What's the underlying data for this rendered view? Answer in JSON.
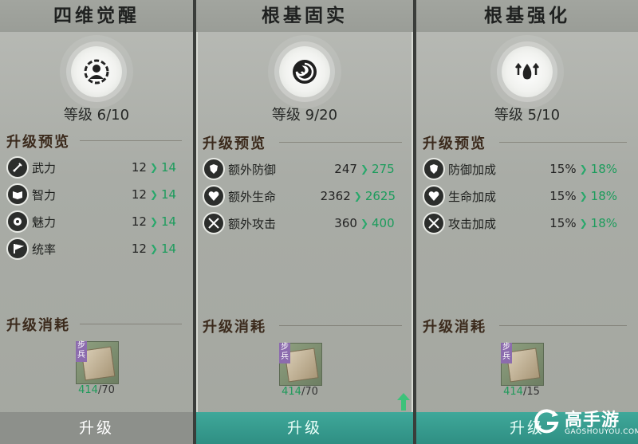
{
  "panels": [
    {
      "title": "四维觉醒",
      "emblem_icon": "person-badge-icon",
      "level": "等级 6/10",
      "preview_title": "升级预览",
      "stats": [
        {
          "icon": "sword-icon",
          "name": "武力",
          "old": "12",
          "new": "14"
        },
        {
          "icon": "book-icon",
          "name": "智力",
          "old": "12",
          "new": "14"
        },
        {
          "icon": "charm-icon",
          "name": "魅力",
          "old": "12",
          "new": "14"
        },
        {
          "icon": "banner-icon",
          "name": "统率",
          "old": "12",
          "new": "14"
        }
      ],
      "cost_title": "升级消耗",
      "cost_tag": "步兵",
      "cost_have": "414",
      "cost_need": "/70",
      "button": "升级"
    },
    {
      "title": "根基固实",
      "emblem_icon": "swirl-orb-icon",
      "level": "等级 9/20",
      "preview_title": "升级预览",
      "stats": [
        {
          "icon": "shield-icon",
          "name": "额外防御",
          "old": "247",
          "new": "275"
        },
        {
          "icon": "heart-icon",
          "name": "额外生命",
          "old": "2362",
          "new": "2625"
        },
        {
          "icon": "crossed-swords-icon",
          "name": "额外攻击",
          "old": "360",
          "new": "400"
        }
      ],
      "cost_title": "升级消耗",
      "cost_tag": "步兵",
      "cost_have": "414",
      "cost_need": "/70",
      "button": "升级"
    },
    {
      "title": "根基强化",
      "emblem_icon": "flame-up-arrows-icon",
      "level": "等级 5/10",
      "preview_title": "升级预览",
      "stats": [
        {
          "icon": "shield-icon",
          "name": "防御加成",
          "old": "15%",
          "new": "18%"
        },
        {
          "icon": "heart-icon",
          "name": "生命加成",
          "old": "15%",
          "new": "18%"
        },
        {
          "icon": "crossed-swords-icon",
          "name": "攻击加成",
          "old": "15%",
          "new": "18%"
        }
      ],
      "cost_title": "升级消耗",
      "cost_tag": "步兵",
      "cost_have": "414",
      "cost_need": "/15",
      "button": "升级"
    }
  ],
  "watermark": {
    "main": "高手游",
    "sub": "GAOSHOUYOU.COM"
  },
  "colors": {
    "accent_green": "#1c9c5c",
    "button_teal": "#2f8f83",
    "button_grey": "#8d908b"
  }
}
